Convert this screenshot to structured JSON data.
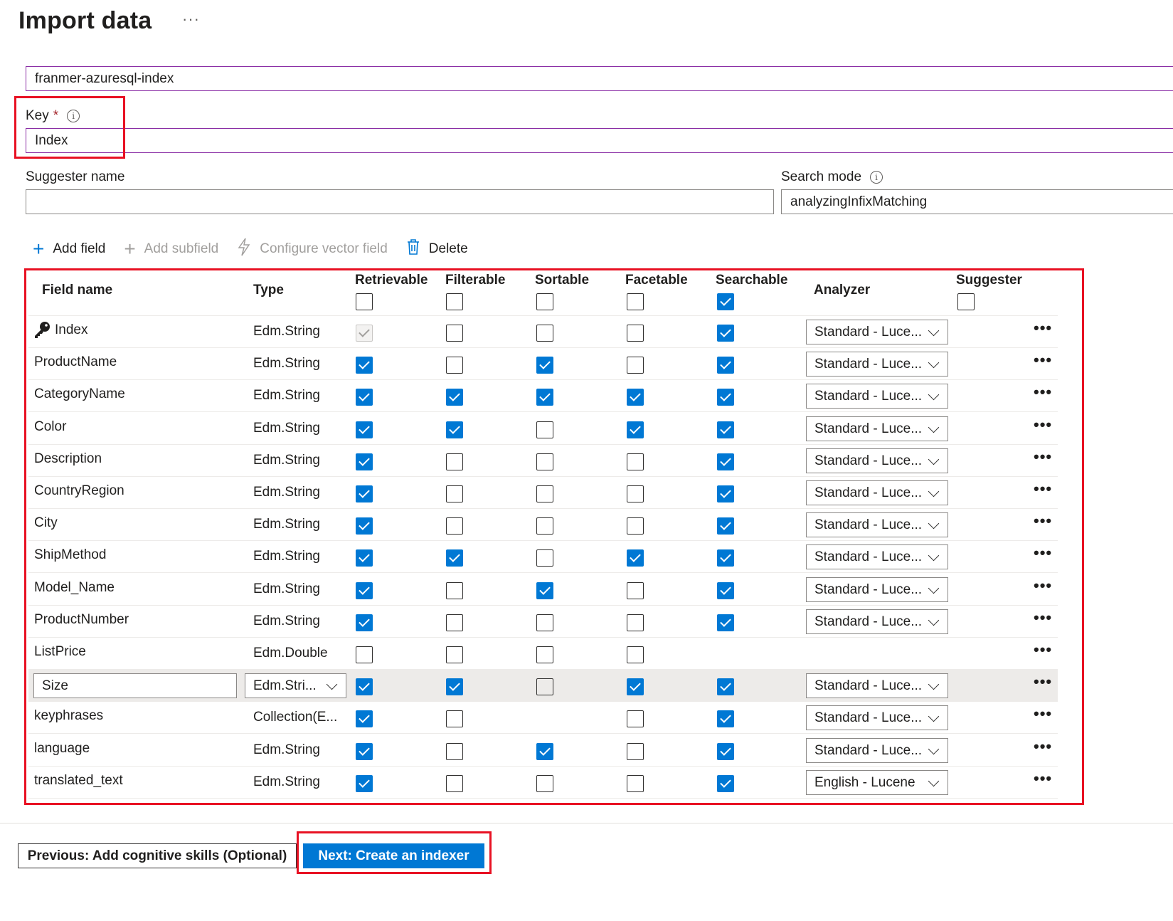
{
  "page": {
    "title": "Import data",
    "more_label": "···"
  },
  "form": {
    "index_name_value": "franmer-azuresql-index",
    "key_label": "Key",
    "key_required": "*",
    "key_value": "Index",
    "suggester_label": "Suggester name",
    "suggester_value": "",
    "search_mode_label": "Search mode",
    "search_mode_value": "analyzingInfixMatching",
    "info_glyph": "i"
  },
  "toolbar": {
    "add_field": "Add field",
    "add_subfield": "Add subfield",
    "configure_vector": "Configure vector field",
    "delete": "Delete"
  },
  "table": {
    "headers": {
      "field_name": "Field name",
      "type": "Type",
      "retrievable": "Retrievable",
      "filterable": "Filterable",
      "sortable": "Sortable",
      "facetable": "Facetable",
      "searchable": "Searchable",
      "analyzer": "Analyzer",
      "suggester": "Suggester"
    },
    "header_checks": {
      "retrievable": false,
      "filterable": false,
      "sortable": false,
      "facetable": false,
      "searchable": true,
      "suggester": false
    },
    "rows": [
      {
        "name": "Index",
        "type": "Edm.String",
        "retrievable": true,
        "retrievable_disabled": true,
        "filterable": false,
        "sortable": false,
        "facetable": false,
        "searchable": true,
        "analyzer": "Standard - Luce...",
        "key": true
      },
      {
        "name": "ProductName",
        "type": "Edm.String",
        "retrievable": true,
        "filterable": false,
        "sortable": true,
        "facetable": false,
        "searchable": true,
        "analyzer": "Standard - Luce..."
      },
      {
        "name": "CategoryName",
        "type": "Edm.String",
        "retrievable": true,
        "filterable": true,
        "sortable": true,
        "facetable": true,
        "searchable": true,
        "analyzer": "Standard - Luce..."
      },
      {
        "name": "Color",
        "type": "Edm.String",
        "retrievable": true,
        "filterable": true,
        "sortable": false,
        "facetable": true,
        "searchable": true,
        "analyzer": "Standard - Luce..."
      },
      {
        "name": "Description",
        "type": "Edm.String",
        "retrievable": true,
        "filterable": false,
        "sortable": false,
        "facetable": false,
        "searchable": true,
        "analyzer": "Standard - Luce..."
      },
      {
        "name": "CountryRegion",
        "type": "Edm.String",
        "retrievable": true,
        "filterable": false,
        "sortable": false,
        "facetable": false,
        "searchable": true,
        "analyzer": "Standard - Luce..."
      },
      {
        "name": "City",
        "type": "Edm.String",
        "retrievable": true,
        "filterable": false,
        "sortable": false,
        "facetable": false,
        "searchable": true,
        "analyzer": "Standard - Luce..."
      },
      {
        "name": "ShipMethod",
        "type": "Edm.String",
        "retrievable": true,
        "filterable": true,
        "sortable": false,
        "facetable": true,
        "searchable": true,
        "analyzer": "Standard - Luce..."
      },
      {
        "name": "Model_Name",
        "type": "Edm.String",
        "retrievable": true,
        "filterable": false,
        "sortable": true,
        "facetable": false,
        "searchable": true,
        "analyzer": "Standard - Luce..."
      },
      {
        "name": "ProductNumber",
        "type": "Edm.String",
        "retrievable": true,
        "filterable": false,
        "sortable": false,
        "facetable": false,
        "searchable": true,
        "analyzer": "Standard - Luce..."
      },
      {
        "name": "ListPrice",
        "type": "Edm.Double",
        "retrievable": false,
        "filterable": false,
        "sortable": false,
        "facetable": false,
        "searchable": null,
        "analyzer": null
      },
      {
        "name": "Size",
        "type": "Edm.Stri...",
        "retrievable": true,
        "filterable": true,
        "sortable": false,
        "facetable": true,
        "searchable": true,
        "analyzer": "Standard - Luce...",
        "editing": true
      },
      {
        "name": "keyphrases",
        "type": "Collection(E...",
        "retrievable": true,
        "filterable": false,
        "sortable": null,
        "facetable": false,
        "searchable": true,
        "analyzer": "Standard - Luce..."
      },
      {
        "name": "language",
        "type": "Edm.String",
        "retrievable": true,
        "filterable": false,
        "sortable": true,
        "facetable": false,
        "searchable": true,
        "analyzer": "Standard - Luce..."
      },
      {
        "name": "translated_text",
        "type": "Edm.String",
        "retrievable": true,
        "filterable": false,
        "sortable": false,
        "facetable": false,
        "searchable": true,
        "analyzer": "English - Lucene"
      }
    ],
    "row_more": "•••"
  },
  "footer": {
    "previous_label": "Previous: Add cognitive skills (Optional)",
    "next_label": "Next: Create an indexer"
  },
  "colors": {
    "accent": "#0078d4",
    "highlight_box": "#e81123",
    "focused_border": "#8a2da5"
  }
}
